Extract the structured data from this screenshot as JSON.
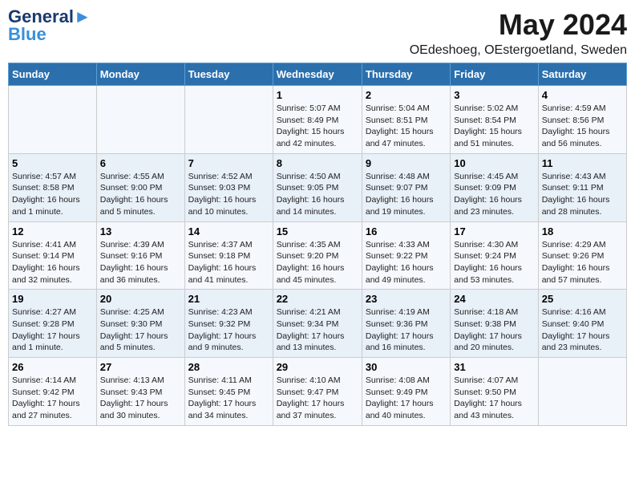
{
  "header": {
    "logo_line1": "General",
    "logo_line2": "Blue",
    "title": "May 2024",
    "subtitle": "OEdeshoeg, OEstergoetland, Sweden"
  },
  "days_of_week": [
    "Sunday",
    "Monday",
    "Tuesday",
    "Wednesday",
    "Thursday",
    "Friday",
    "Saturday"
  ],
  "weeks": [
    [
      {
        "day": "",
        "info": ""
      },
      {
        "day": "",
        "info": ""
      },
      {
        "day": "",
        "info": ""
      },
      {
        "day": "1",
        "info": "Sunrise: 5:07 AM\nSunset: 8:49 PM\nDaylight: 15 hours\nand 42 minutes."
      },
      {
        "day": "2",
        "info": "Sunrise: 5:04 AM\nSunset: 8:51 PM\nDaylight: 15 hours\nand 47 minutes."
      },
      {
        "day": "3",
        "info": "Sunrise: 5:02 AM\nSunset: 8:54 PM\nDaylight: 15 hours\nand 51 minutes."
      },
      {
        "day": "4",
        "info": "Sunrise: 4:59 AM\nSunset: 8:56 PM\nDaylight: 15 hours\nand 56 minutes."
      }
    ],
    [
      {
        "day": "5",
        "info": "Sunrise: 4:57 AM\nSunset: 8:58 PM\nDaylight: 16 hours\nand 1 minute."
      },
      {
        "day": "6",
        "info": "Sunrise: 4:55 AM\nSunset: 9:00 PM\nDaylight: 16 hours\nand 5 minutes."
      },
      {
        "day": "7",
        "info": "Sunrise: 4:52 AM\nSunset: 9:03 PM\nDaylight: 16 hours\nand 10 minutes."
      },
      {
        "day": "8",
        "info": "Sunrise: 4:50 AM\nSunset: 9:05 PM\nDaylight: 16 hours\nand 14 minutes."
      },
      {
        "day": "9",
        "info": "Sunrise: 4:48 AM\nSunset: 9:07 PM\nDaylight: 16 hours\nand 19 minutes."
      },
      {
        "day": "10",
        "info": "Sunrise: 4:45 AM\nSunset: 9:09 PM\nDaylight: 16 hours\nand 23 minutes."
      },
      {
        "day": "11",
        "info": "Sunrise: 4:43 AM\nSunset: 9:11 PM\nDaylight: 16 hours\nand 28 minutes."
      }
    ],
    [
      {
        "day": "12",
        "info": "Sunrise: 4:41 AM\nSunset: 9:14 PM\nDaylight: 16 hours\nand 32 minutes."
      },
      {
        "day": "13",
        "info": "Sunrise: 4:39 AM\nSunset: 9:16 PM\nDaylight: 16 hours\nand 36 minutes."
      },
      {
        "day": "14",
        "info": "Sunrise: 4:37 AM\nSunset: 9:18 PM\nDaylight: 16 hours\nand 41 minutes."
      },
      {
        "day": "15",
        "info": "Sunrise: 4:35 AM\nSunset: 9:20 PM\nDaylight: 16 hours\nand 45 minutes."
      },
      {
        "day": "16",
        "info": "Sunrise: 4:33 AM\nSunset: 9:22 PM\nDaylight: 16 hours\nand 49 minutes."
      },
      {
        "day": "17",
        "info": "Sunrise: 4:30 AM\nSunset: 9:24 PM\nDaylight: 16 hours\nand 53 minutes."
      },
      {
        "day": "18",
        "info": "Sunrise: 4:29 AM\nSunset: 9:26 PM\nDaylight: 16 hours\nand 57 minutes."
      }
    ],
    [
      {
        "day": "19",
        "info": "Sunrise: 4:27 AM\nSunset: 9:28 PM\nDaylight: 17 hours\nand 1 minute."
      },
      {
        "day": "20",
        "info": "Sunrise: 4:25 AM\nSunset: 9:30 PM\nDaylight: 17 hours\nand 5 minutes."
      },
      {
        "day": "21",
        "info": "Sunrise: 4:23 AM\nSunset: 9:32 PM\nDaylight: 17 hours\nand 9 minutes."
      },
      {
        "day": "22",
        "info": "Sunrise: 4:21 AM\nSunset: 9:34 PM\nDaylight: 17 hours\nand 13 minutes."
      },
      {
        "day": "23",
        "info": "Sunrise: 4:19 AM\nSunset: 9:36 PM\nDaylight: 17 hours\nand 16 minutes."
      },
      {
        "day": "24",
        "info": "Sunrise: 4:18 AM\nSunset: 9:38 PM\nDaylight: 17 hours\nand 20 minutes."
      },
      {
        "day": "25",
        "info": "Sunrise: 4:16 AM\nSunset: 9:40 PM\nDaylight: 17 hours\nand 23 minutes."
      }
    ],
    [
      {
        "day": "26",
        "info": "Sunrise: 4:14 AM\nSunset: 9:42 PM\nDaylight: 17 hours\nand 27 minutes."
      },
      {
        "day": "27",
        "info": "Sunrise: 4:13 AM\nSunset: 9:43 PM\nDaylight: 17 hours\nand 30 minutes."
      },
      {
        "day": "28",
        "info": "Sunrise: 4:11 AM\nSunset: 9:45 PM\nDaylight: 17 hours\nand 34 minutes."
      },
      {
        "day": "29",
        "info": "Sunrise: 4:10 AM\nSunset: 9:47 PM\nDaylight: 17 hours\nand 37 minutes."
      },
      {
        "day": "30",
        "info": "Sunrise: 4:08 AM\nSunset: 9:49 PM\nDaylight: 17 hours\nand 40 minutes."
      },
      {
        "day": "31",
        "info": "Sunrise: 4:07 AM\nSunset: 9:50 PM\nDaylight: 17 hours\nand 43 minutes."
      },
      {
        "day": "",
        "info": ""
      }
    ]
  ]
}
